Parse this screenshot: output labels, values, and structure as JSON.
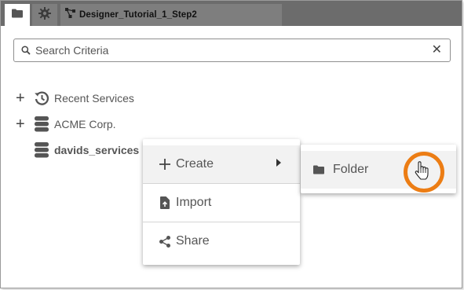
{
  "tabs": [
    {
      "icon": "folder-icon",
      "label": ""
    },
    {
      "icon": "gear-icon",
      "label": ""
    },
    {
      "icon": "workflow-icon",
      "label": "Designer_Tutorial_1_Step2"
    }
  ],
  "search": {
    "placeholder": "Search Criteria",
    "value": ""
  },
  "tree": [
    {
      "expander": "+",
      "icon": "history-icon",
      "label": "Recent Services"
    },
    {
      "expander": "+",
      "icon": "database-icon",
      "label": "ACME Corp."
    },
    {
      "expander": "",
      "icon": "database-icon",
      "label": "davids_services"
    }
  ],
  "context_menu": {
    "items": [
      {
        "icon": "plus-icon",
        "label": "Create",
        "has_submenu": true
      },
      {
        "icon": "file-upload-icon",
        "label": "Import"
      },
      {
        "icon": "share-icon",
        "label": "Share"
      }
    ]
  },
  "submenu": {
    "items": [
      {
        "icon": "folder-icon",
        "label": "Folder"
      }
    ]
  },
  "colors": {
    "tabbar": "#6c6c6c",
    "highlight_ring": "#ec7d14",
    "menu_hover": "#f2f2f2"
  }
}
